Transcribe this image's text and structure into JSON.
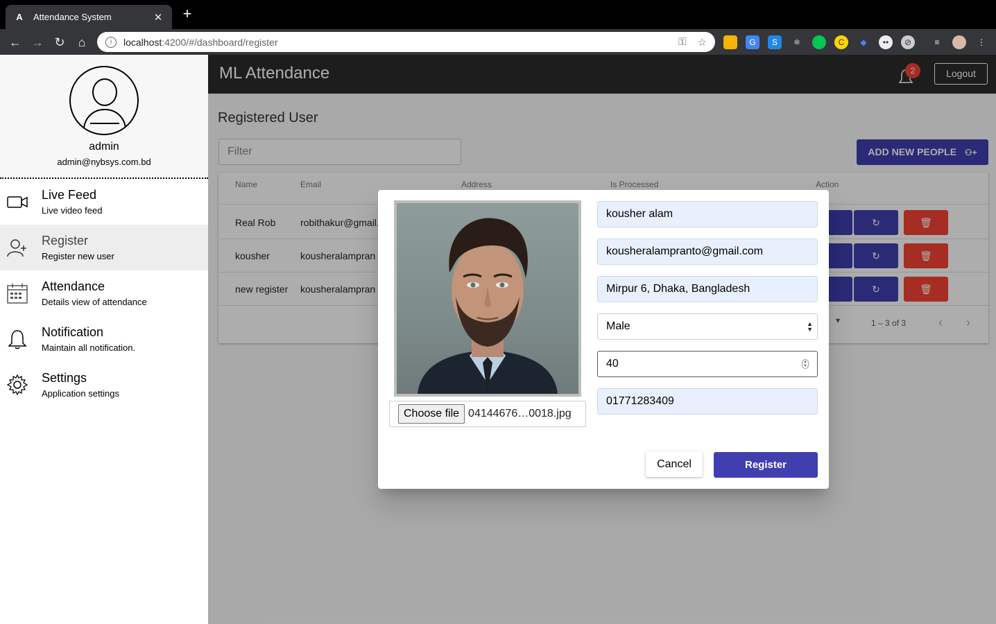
{
  "browser": {
    "tab_title": "Attendance System",
    "tab_favicon": "A",
    "url_host": "localhost",
    "url_path": ":4200/#/dashboard/register"
  },
  "profile": {
    "name": "admin",
    "email": "admin@nybsys.com.bd"
  },
  "sidebar": {
    "items": [
      {
        "label": "Live Feed",
        "sub": "Live video feed",
        "icon": "video-camera-icon"
      },
      {
        "label": "Register",
        "sub": "Register new user",
        "icon": "add-user-icon"
      },
      {
        "label": "Attendance",
        "sub": "Details view of attendance",
        "icon": "calendar-icon"
      },
      {
        "label": "Notification",
        "sub": "Maintain all notification.",
        "icon": "bell-icon"
      },
      {
        "label": "Settings",
        "sub": "Application settings",
        "icon": "gear-icon"
      }
    ],
    "active_index": 1
  },
  "header": {
    "title": "ML Attendance",
    "notification_count": "2",
    "logout_label": "Logout"
  },
  "page": {
    "title": "Registered User",
    "filter_placeholder": "Filter",
    "add_button_label": "ADD NEW PEOPLE",
    "columns": [
      "Name",
      "Email",
      "Address",
      "Is Processed",
      "Action"
    ],
    "rows": [
      {
        "name": "Real Rob",
        "email": "robithakur@gmail."
      },
      {
        "name": "kousher",
        "email": "kousheralampran"
      },
      {
        "name": "new register",
        "email": "kousheralampran"
      }
    ],
    "pager_range": "1 – 3 of 3"
  },
  "dialog": {
    "file_button_label": "Choose file",
    "file_name": "04144676…0018.jpg",
    "name_value": "kousher alam",
    "email_value": "kousheralampranto@gmail.com",
    "address_value": "Mirpur 6, Dhaka, Bangladesh",
    "gender_value": "Male",
    "age_value": "40",
    "phone_value": "01771283409",
    "cancel_label": "Cancel",
    "register_label": "Register"
  },
  "colors": {
    "accent": "#3f3fb0",
    "danger": "#f44336",
    "header": "#2c2c2c",
    "autofill": "#e8f0fe"
  }
}
